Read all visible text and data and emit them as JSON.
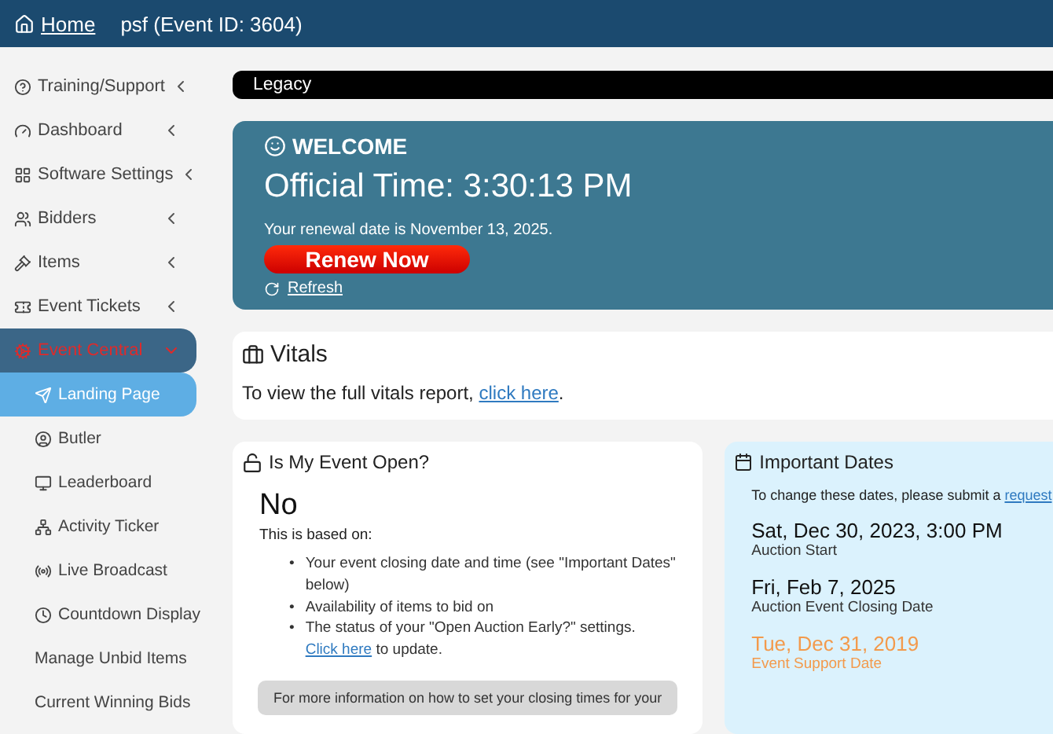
{
  "header": {
    "home_link": "Home",
    "event_title": "psf (Event ID: 3604)"
  },
  "sidebar": {
    "items": [
      {
        "label": "Training/Support",
        "expanded": false
      },
      {
        "label": "Dashboard",
        "expanded": false
      },
      {
        "label": "Software Settings",
        "expanded": false
      },
      {
        "label": "Bidders",
        "expanded": false
      },
      {
        "label": "Items",
        "expanded": false
      },
      {
        "label": "Event Tickets",
        "expanded": false
      },
      {
        "label": "Event Central",
        "expanded": true,
        "children": [
          {
            "label": "Landing Page",
            "selected": true
          },
          {
            "label": "Butler",
            "selected": false
          },
          {
            "label": "Leaderboard",
            "selected": false
          },
          {
            "label": "Activity Ticker",
            "selected": false
          },
          {
            "label": "Live Broadcast",
            "selected": false
          },
          {
            "label": "Countdown Display",
            "selected": false
          },
          {
            "label": "Manage Unbid Items",
            "selected": false
          },
          {
            "label": "Current Winning Bids",
            "selected": false
          }
        ]
      }
    ]
  },
  "legacy_bar": {
    "label": "Legacy"
  },
  "welcome": {
    "heading": "WELCOME",
    "official_time": "Official Time: 3:30:13 PM",
    "renewal_text": "Your renewal date is November 13, 2025.",
    "renew_button": "Renew Now",
    "refresh_link": "Refresh"
  },
  "vitals": {
    "heading": "Vitals",
    "text_before": "To view the full vitals report, ",
    "link": "click here",
    "text_after": "."
  },
  "event_open": {
    "heading": "Is My Event Open?",
    "answer": "No",
    "intro": "This is based on:",
    "bullets": [
      {
        "marker": "•",
        "text": "Your event closing date and time (see \"Important Dates\" below)"
      },
      {
        "marker": "•",
        "text": "Availability of items to bid on"
      },
      {
        "marker": "•",
        "text": "The status of your \"Open Auction Early?\" settings. ",
        "link": "Click here",
        "after": " to update."
      }
    ],
    "note": "For more information on how to set your closing times for your"
  },
  "important_dates": {
    "heading": "Important Dates",
    "intro": "To change these dates, please submit a ",
    "intro_link": "request",
    "dates": [
      {
        "date": "Sat, Dec 30, 2023, 3:00 PM",
        "label": "Auction Start",
        "kind": "normal"
      },
      {
        "date": "Fri, Feb 7, 2025",
        "label": "Auction Event Closing Date",
        "kind": "normal"
      },
      {
        "date": "Tue, Dec 31, 2019",
        "label": "Event Support Date",
        "kind": "warning"
      }
    ]
  }
}
